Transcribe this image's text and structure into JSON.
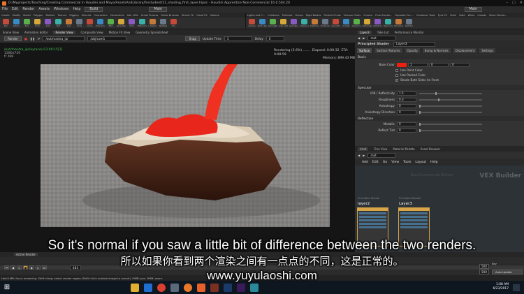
{
  "window": {
    "title": "D:/Myprojects/Teaching/Creating Commercial in Houdini and Maya/AssetsAndLibrary/forstudent/22_shading_first_layer.hipnc - Houdini Apprentice Non-Commercial 16.0.504.20"
  },
  "menu": {
    "items": [
      "File",
      "Edit",
      "Render",
      "Assets",
      "Windows",
      "Help"
    ],
    "desktop_left": "Build",
    "desktop_right": "Main"
  },
  "shelf_left": {
    "tabs": [
      "Create",
      "Modify",
      "Model",
      "Polygon",
      "Deform",
      "Texture",
      "Rigging",
      "Muscles",
      "Characters",
      "Constraints",
      "Hair Utils",
      "Guide Process",
      "Guide Brushes",
      "Terrain FX",
      "Cloud FX",
      "Volume"
    ],
    "tools": [
      "Box",
      "Sphere",
      "Tube",
      "Torus",
      "Grid",
      "Null",
      "Line",
      "Circle",
      "Curve",
      "Draw Curve",
      "Path",
      "Spray Paint",
      "Font",
      "Platonic Solids",
      "L-System",
      "Metaball",
      "File"
    ]
  },
  "shelf_right": {
    "tabs": [
      "Lights and C...",
      "Collisions",
      "Particles",
      "Grains",
      "Rigid Bodies",
      "Particle Fluids",
      "Viscous Fluids",
      "Oceans",
      "Fluid Contai...",
      "Populate Con...",
      "Container Tools",
      "Pyro FX",
      "Cloth",
      "Solid",
      "Wires",
      "Crowds",
      "Drive Simula..."
    ],
    "tools": [
      "Camera",
      "Point Light",
      "Spot Light",
      "Area Light",
      "Geometry Light",
      "Volume Light",
      "Distant Light",
      "Environment Light",
      "Sky Light",
      "GI Light",
      "Caustic Light",
      "Portal Light",
      "Ambient Light",
      "Stereo Camera",
      "VR Camera",
      "Switcher"
    ]
  },
  "left_pane": {
    "tabs": [
      "Scene View",
      "Animation Editor",
      "Render View",
      "Composite View",
      "Motion FX View",
      "Geometry Spreadsheet"
    ],
    "active_tab": "Render View",
    "render_button": "Render",
    "renderer": "/out/mantra_ipr",
    "camera": "/obj/cam1",
    "snap_label": "Snap",
    "update_time_label": "Update Time",
    "update_time_value": "1",
    "delay_label": "Delay",
    "delay_value": "0"
  },
  "viewport": {
    "info_path": "/out/mantra_ipr/ayrace)-03:09:15[1]",
    "info_res": "1280x720",
    "info_fr": "fr 484",
    "status_rendering": "Rendering (5.6%) .......",
    "status_elapsed": "Elapsed: 0:00:32",
    "status_eta": "ETA: 0:08:59",
    "status_memory": "Memory: 899.43 MB"
  },
  "param_pane": {
    "tabs": [
      "Layer3",
      "Take List",
      "Performance Monitor"
    ],
    "path": "mat",
    "node_type": "Principled Shader",
    "node_name": "Layer3",
    "subtabs": [
      "Surface",
      "Surface Textures",
      "Opacity",
      "Bump & Normals",
      "Displacement",
      "Settings"
    ],
    "active_subtab": "Surface",
    "section_basic": "Basic",
    "base_color_label": "Base Color",
    "base_color_values": [
      "1",
      "0",
      "0"
    ],
    "base_color_hex": "#f02010",
    "use_point_color": "Use Point Color",
    "use_packed_color": "Use Packed Color",
    "shade_both_sides": "Shade Both Sides As Front",
    "section_specular": "Specular",
    "params": [
      {
        "label": "IOR / Reflectivity",
        "value": "1.5",
        "frac": 0.25
      },
      {
        "label": "Roughness",
        "value": "0.3",
        "frac": 0.3
      },
      {
        "label": "Anisotropy",
        "value": "0",
        "frac": 0.0
      },
      {
        "label": "Anisotropy Direction",
        "value": "0",
        "frac": 0.0
      }
    ],
    "section_reflection": "Reflection",
    "params2": [
      {
        "label": "Metallic",
        "value": "0",
        "frac": 0.0
      },
      {
        "label": "Reflect Tint",
        "value": "0",
        "frac": 0.0
      }
    ]
  },
  "network": {
    "tabs": [
      "/mat",
      "Tree View",
      "Material Palette",
      "Asset Browser"
    ],
    "path": "mat",
    "menu": [
      "Add",
      "Edit",
      "Go",
      "View",
      "Tools",
      "Layout",
      "Help"
    ],
    "bg_title": "Non-Commercial Edition",
    "context_label": "VEX Builder",
    "nodes": [
      {
        "subtitle": "Principled Shader",
        "name": "layer2"
      },
      {
        "subtitle": "Principled Shader",
        "name": "Layer3"
      }
    ]
  },
  "timeline": {
    "tab": "Active Render",
    "frame": "484",
    "end1": "500",
    "end2": "500",
    "auto_update": "Auto Update",
    "key_label": "Key"
  },
  "statusbar": {
    "text": "Hold LMB: focus rendering. Shift+drag: select render region (Shift+click outside image to cancel). MMB: pan. RMB: zoom."
  },
  "taskbar": {
    "time": "1:08 AM",
    "date": "6/23/2017"
  },
  "subtitles": {
    "english": "So it's normal if you saw a little bit of difference between the two renders.",
    "chinese": "所以如果你看到两个渲染之间有一点点的不同，这是正常的。",
    "url": "www.yuyulaoshi.com"
  }
}
